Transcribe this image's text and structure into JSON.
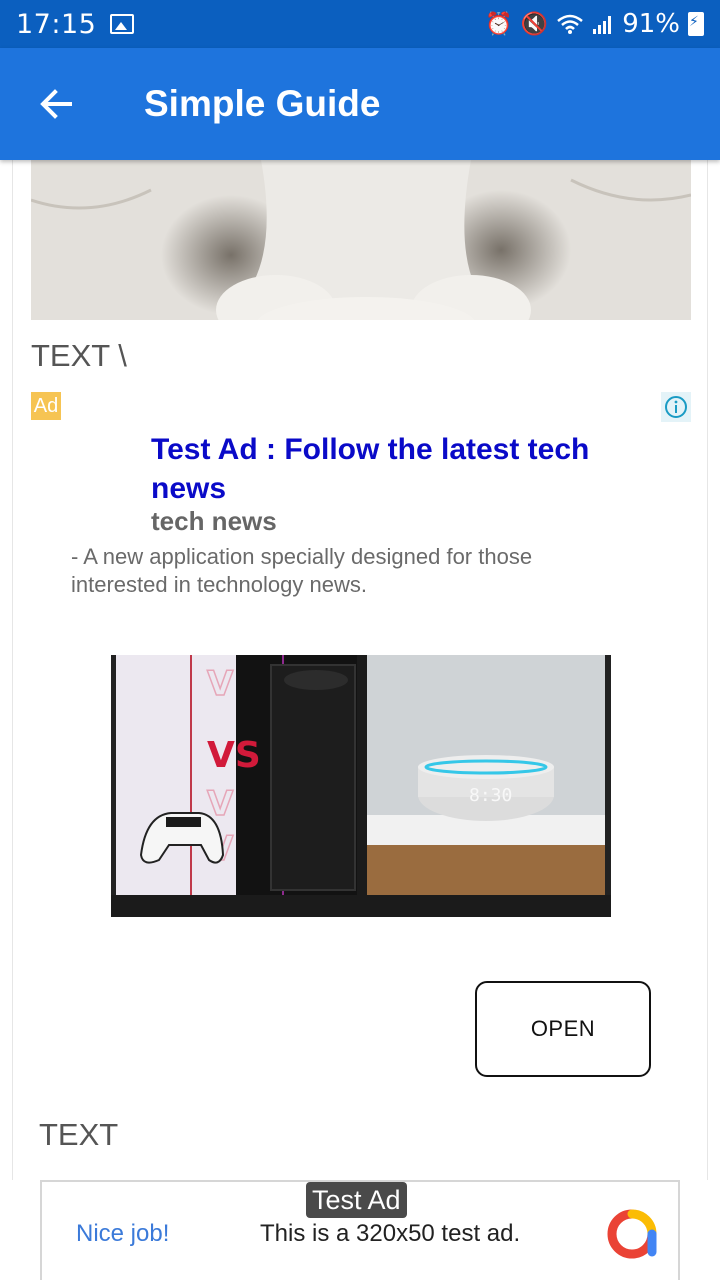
{
  "status_bar": {
    "time": "17:15",
    "battery_percent": "91%"
  },
  "app_bar": {
    "title": "Simple Guide",
    "back_icon": "arrow-back-icon"
  },
  "content": {
    "text_1": "TEXT \\",
    "text_2": "TEXT"
  },
  "native_ad": {
    "badge": "Ad",
    "headline": "Test Ad : Follow the latest tech news",
    "advertiser": "tech news",
    "body": "- A new application specially designed for those interested in technology news.",
    "media_clock_text": "8:30",
    "media_vs_text": "VS",
    "cta_label": "OPEN",
    "info_icon": "info-icon"
  },
  "banner_ad": {
    "tag": "Test Ad",
    "nice_text": "Nice job!",
    "message": "This is a 320x50 test ad."
  },
  "colors": {
    "status_bar": "#0b5fbf",
    "app_bar": "#1e74dd",
    "headline": "#0a0ac8",
    "ad_badge": "#f6c453"
  }
}
